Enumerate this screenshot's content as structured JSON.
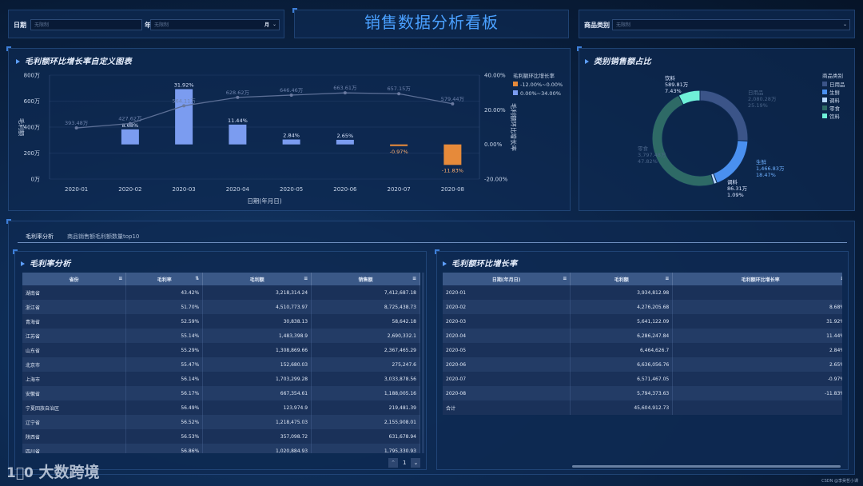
{
  "header": {
    "title": "销售数据分析看板",
    "date_label": "日期",
    "date_start_placeholder": "无限制",
    "year_label": "年",
    "date_end_placeholder": "无限制",
    "month_label": "月",
    "category_label": "商品类别",
    "category_placeholder": "无限制"
  },
  "combo_chart": {
    "title": "毛利额环比增长率自定义图表",
    "chart_data": {
      "type": "bar",
      "categories": [
        "2020-01",
        "2020-02",
        "2020-03",
        "2020-04",
        "2020-05",
        "2020-06",
        "2020-07",
        "2020-08"
      ],
      "series": [
        {
          "name": "毛利额",
          "type": "line",
          "values": [
            393.48,
            427.62,
            564.11,
            628.62,
            646.46,
            663.61,
            657.15,
            579.44
          ],
          "labels": [
            "393.48万",
            "427.62万",
            "564.11万",
            "628.62万",
            "646.46万",
            "663.61万",
            "657.15万",
            "579.44万"
          ]
        },
        {
          "name": "毛利额环比增长率",
          "type": "bar",
          "values": [
            null,
            8.68,
            31.92,
            11.44,
            2.84,
            2.65,
            -0.97,
            -11.83
          ],
          "labels": [
            "",
            "8.68%",
            "31.92%",
            "11.44%",
            "2.84%",
            "2.65%",
            "-0.97%",
            "-11.83%"
          ]
        }
      ],
      "xlabel": "日期(年月日)",
      "ylabel_left": "毛利额",
      "ylabel_right": "毛利额环比增长率",
      "ylim_left": [
        0,
        800
      ],
      "ylim_right": [
        -20,
        40
      ],
      "left_ticks": [
        "800万",
        "600万",
        "400万",
        "200万",
        "0万"
      ],
      "right_ticks": [
        "40.00%",
        "20.00%",
        "0.00%",
        "-20.00%"
      ],
      "legend_title": "毛利额环比增长率",
      "legend": [
        {
          "label": "-12.00%~0.00%",
          "color": "#e68a3a"
        },
        {
          "label": "0.00%~34.00%",
          "color": "#7b9cf0"
        }
      ]
    }
  },
  "donut_chart": {
    "title": "类别销售额占比",
    "chart_data": {
      "type": "pie",
      "legend_title": "商品类别",
      "slices": [
        {
          "name": "日用品",
          "value": 2080.28,
          "value_label": "2,080.28万",
          "pct": "25.19%",
          "color": "#3b5488"
        },
        {
          "name": "生鲜",
          "value": 1466.83,
          "value_label": "1,466.83万",
          "pct": "18.47%",
          "color": "#4a90f0"
        },
        {
          "name": "调料",
          "value": 86.31,
          "value_label": "86.31万",
          "pct": "1.09%",
          "color": "#b8d8ff"
        },
        {
          "name": "零食",
          "value": 3797.48,
          "value_label": "3,797.48万",
          "pct": "47.82%",
          "color": "#2e6a66"
        },
        {
          "name": "饮料",
          "value": 589.81,
          "value_label": "589.81万",
          "pct": "7.43%",
          "color": "#6ff0d8"
        }
      ]
    }
  },
  "tabs": [
    "毛利率分析",
    "商品销售额毛利额数量top10"
  ],
  "margin_table": {
    "title": "毛利率分析",
    "columns": [
      "省份",
      "毛利率",
      "毛利额",
      "销售额"
    ],
    "rows": [
      [
        "湖南省",
        "43.42%",
        "3,218,314.24",
        "7,412,687.18"
      ],
      [
        "浙江省",
        "51.70%",
        "4,510,773.97",
        "8,725,438.73"
      ],
      [
        "青海省",
        "52.59%",
        "30,838.13",
        "58,642.18"
      ],
      [
        "江苏省",
        "55.14%",
        "1,483,398.9",
        "2,690,332.1"
      ],
      [
        "山东省",
        "55.29%",
        "1,308,869.66",
        "2,367,465.29"
      ],
      [
        "北京市",
        "55.47%",
        "152,680.03",
        "275,247.6"
      ],
      [
        "上海市",
        "56.14%",
        "1,703,299.28",
        "3,033,878.56"
      ],
      [
        "安徽省",
        "56.17%",
        "667,354.61",
        "1,188,005.16"
      ],
      [
        "宁夏回族自治区",
        "56.49%",
        "123,974.9",
        "219,481.39"
      ],
      [
        "辽宁省",
        "56.52%",
        "1,218,475.03",
        "2,155,908.01"
      ],
      [
        "陕西省",
        "56.53%",
        "357,098.72",
        "631,678.94"
      ],
      [
        "四川省",
        "56.86%",
        "1,020,884.93",
        "1,795,330.93"
      ]
    ],
    "page": "1"
  },
  "growth_table": {
    "title": "毛利额环比增长率",
    "columns": [
      "日期(年月日)",
      "毛利额",
      "毛利额环比增长率"
    ],
    "rows": [
      [
        "2020-01",
        "3,934,812.98",
        ""
      ],
      [
        "2020-02",
        "4,276,205.68",
        "8.68%"
      ],
      [
        "2020-03",
        "5,641,122.09",
        "31.92%"
      ],
      [
        "2020-04",
        "6,286,247.84",
        "11.44%"
      ],
      [
        "2020-05",
        "6,464,626.7",
        "2.84%"
      ],
      [
        "2020-06",
        "6,636,056.76",
        "2.65%"
      ],
      [
        "2020-07",
        "6,571,467.05",
        "-0.97%"
      ],
      [
        "2020-08",
        "5,794,373.63",
        "-11.83%"
      ]
    ],
    "total": [
      "合计",
      "45,604,912.73",
      ""
    ]
  },
  "brand": "大数跨境",
  "credit": "CSDN @李昊哲小课"
}
